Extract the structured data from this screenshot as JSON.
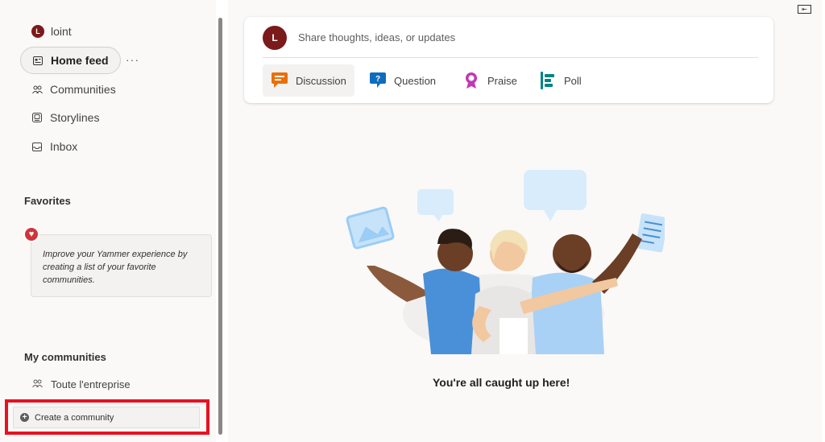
{
  "sidebar": {
    "user": {
      "initial": "L",
      "name": "loint"
    },
    "nav": [
      {
        "label": "Home feed",
        "icon": "home-feed-icon",
        "active": true
      },
      {
        "label": "Communities",
        "icon": "communities-icon"
      },
      {
        "label": "Storylines",
        "icon": "storylines-icon"
      },
      {
        "label": "Inbox",
        "icon": "inbox-icon"
      }
    ],
    "more_label": "···",
    "favorites": {
      "title": "Favorites",
      "hint": "Improve your Yammer experience by creating a list of your favorite communities."
    },
    "my_communities": {
      "title": "My communities",
      "items": [
        {
          "label": "Toute l'entreprise",
          "icon": "community-icon"
        }
      ],
      "create_label": "Create a community"
    }
  },
  "composer": {
    "avatar_initial": "L",
    "placeholder": "Share thoughts, ideas, or updates",
    "tabs": [
      {
        "label": "Discussion",
        "icon": "discussion-icon",
        "color": "#e8700a",
        "selected": true
      },
      {
        "label": "Question",
        "icon": "question-icon",
        "color": "#0f6cbd"
      },
      {
        "label": "Praise",
        "icon": "praise-icon",
        "color": "#c239b3"
      },
      {
        "label": "Poll",
        "icon": "poll-icon",
        "color": "#038387"
      }
    ]
  },
  "feed": {
    "empty_message": "You're all caught up here!"
  },
  "colors": {
    "avatar": "#7a1a1a",
    "highlight": "#e81123",
    "heart": "#d13438"
  }
}
